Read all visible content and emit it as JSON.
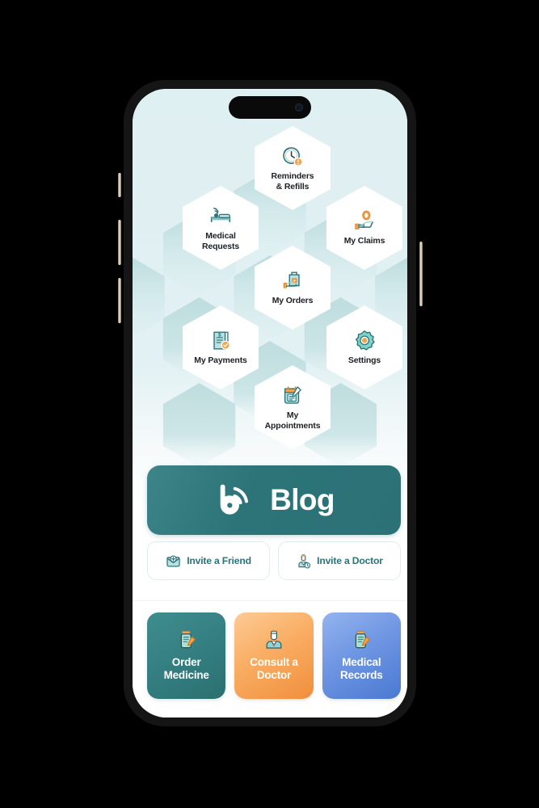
{
  "device": {
    "name": "smartphone-mockup",
    "frame_color": "#c9b9a0",
    "bezel_color": "#151515"
  },
  "screen": {
    "background_top_color": "#dff0f2",
    "background_bottom_color": "#ffffff",
    "hex_pattern_color": "#c3dee0",
    "accent_teal": "#2d7479",
    "accent_orange": "#f5a24b",
    "accent_blue": "#6d94e0"
  },
  "hex_menu": {
    "items": [
      {
        "id": "reminders",
        "label": "Reminders\n& Refills",
        "label_line1": "Reminders",
        "label_line2": "& Refills",
        "icon": "clock-refill-icon"
      },
      {
        "id": "medical-requests",
        "label": "Medical\nRequests",
        "label_line1": "Medical",
        "label_line2": "Requests",
        "icon": "patient-bed-signal-icon"
      },
      {
        "id": "my-claims",
        "label": "My Claims",
        "label_line1": "My Claims",
        "label_line2": "",
        "icon": "hand-coin-icon"
      },
      {
        "id": "my-orders",
        "label": "My Orders",
        "label_line1": "My Orders",
        "label_line2": "",
        "icon": "hand-shopping-bag-icon"
      },
      {
        "id": "my-payments",
        "label": "My Payments",
        "label_line1": "My Payments",
        "label_line2": "",
        "icon": "invoice-coin-icon"
      },
      {
        "id": "settings",
        "label": "Settings",
        "label_line1": "Settings",
        "label_line2": "",
        "icon": "gear-icon"
      },
      {
        "id": "my-appointments",
        "label": "My\nAppointments",
        "label_line1": "My",
        "label_line2": "Appointments",
        "icon": "calendar-pen-icon"
      }
    ]
  },
  "blog_banner": {
    "label": "Blog",
    "icon": "blog-b-waves-icon",
    "background_color": "#2d7479",
    "text_color": "#ffffff"
  },
  "invite_buttons": [
    {
      "id": "invite-a-friend",
      "label": "Invite a Friend",
      "icon": "envelope-plus-icon"
    },
    {
      "id": "invite-a-doctor",
      "label": "Invite a Doctor",
      "icon": "doctor-clock-icon"
    }
  ],
  "action_cards": [
    {
      "id": "order-medicine",
      "label_line1": "Order",
      "label_line2": "Medicine",
      "icon": "pill-bottle-icon",
      "color_start": "#3d8a8b",
      "color_end": "#2c7373"
    },
    {
      "id": "consult-a-doctor",
      "label_line1": "Consult a",
      "label_line2": "Doctor",
      "icon": "doctor-icon",
      "color_start": "#fbc389",
      "color_end": "#f4913f"
    },
    {
      "id": "medical-records",
      "label_line1": "Medical",
      "label_line2": "Records",
      "icon": "pill-bottle-icon-2",
      "color_start": "#8fb0ee",
      "color_end": "#4f7fd6"
    }
  ]
}
